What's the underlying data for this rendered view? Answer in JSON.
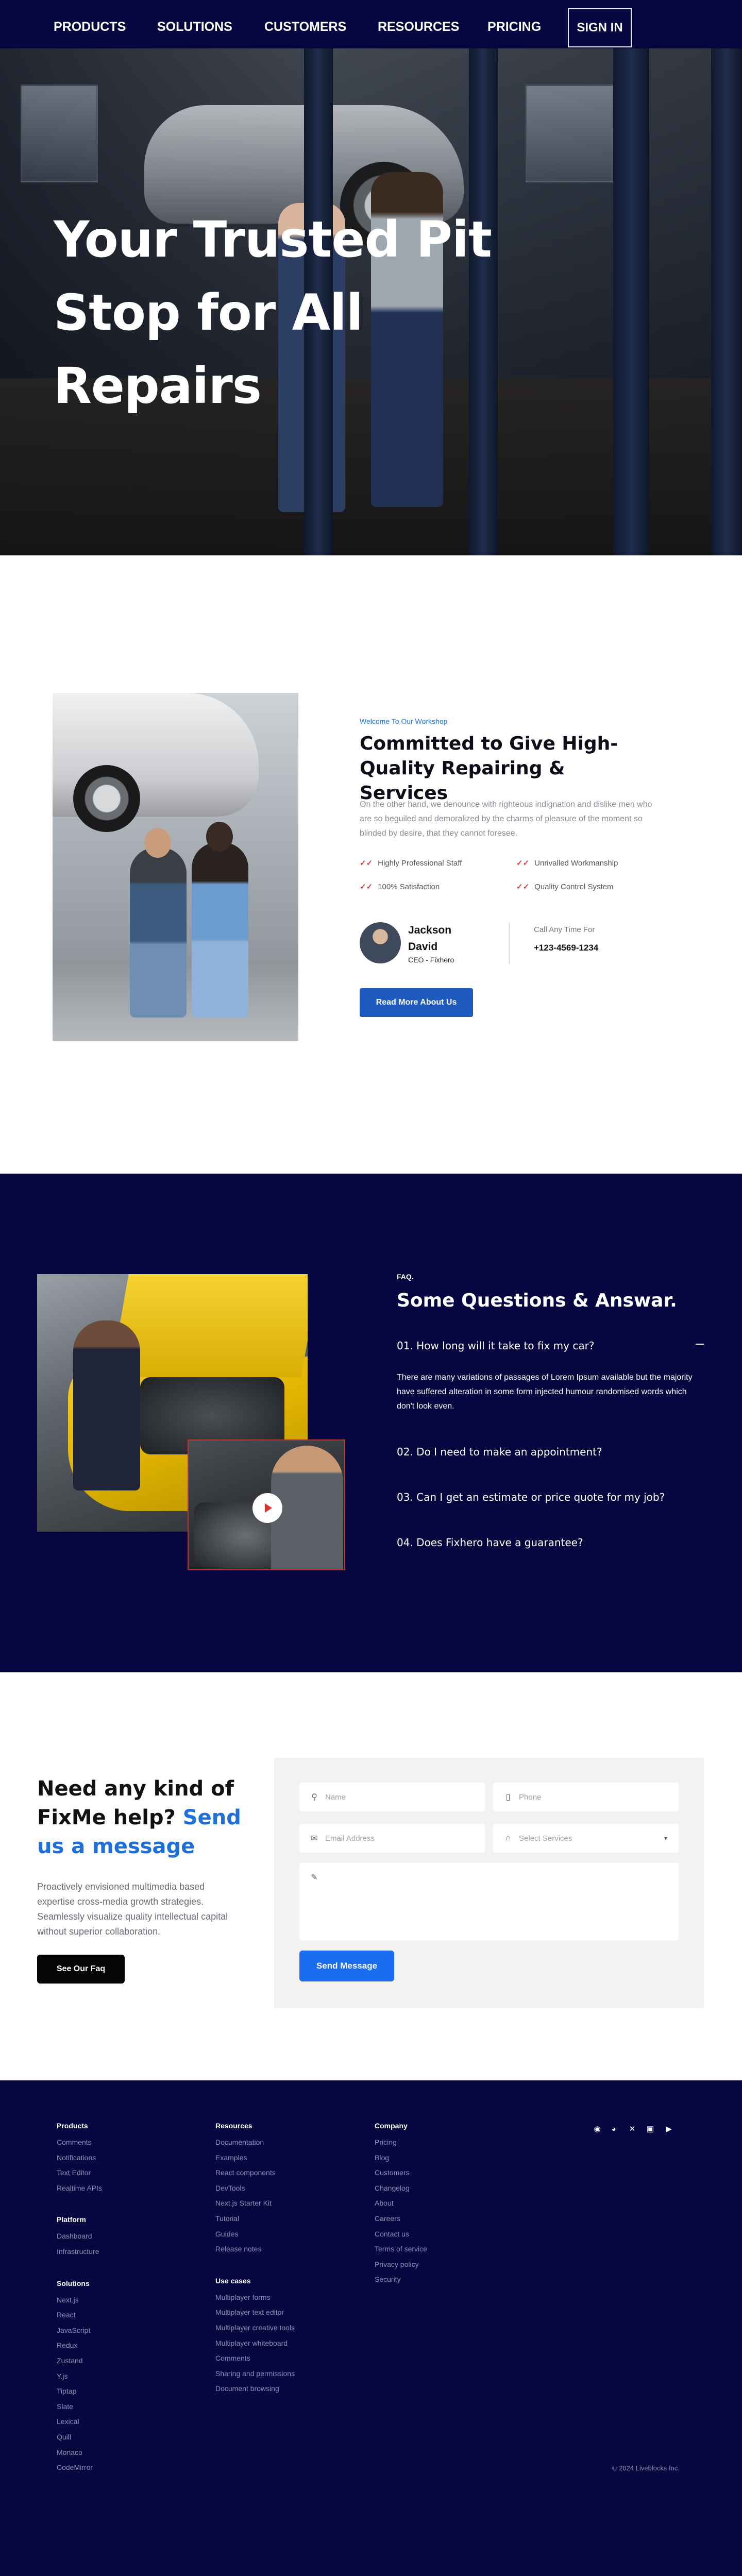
{
  "nav": {
    "items": [
      "PRODUCTS",
      "SOLUTIONS",
      "CUSTOMERS",
      "RESOURCES",
      "PRICING"
    ],
    "signin": "SIGN IN"
  },
  "hero": {
    "title": "Your Trusted Pit Stop for All Repairs"
  },
  "about": {
    "kicker": "Welcome To Our Workshop",
    "title": "Committed to Give High-Quality Repairing & Services",
    "text": "On the other hand, we denounce with righteous indignation and dislike men who are so beguiled and demoralized by the charms of pleasure of the moment so blinded by desire, that they cannot foresee.",
    "features": [
      "Highly Professional Staff",
      "Unrivalled Workmanship",
      "100% Satisfaction",
      "Quality Control System"
    ],
    "person_name": "Jackson David",
    "person_role": "CEO - Fixhero",
    "call_label": "Call Any Time For",
    "call_number": "+123-4569-1234",
    "button": "Read More About Us"
  },
  "faq": {
    "kicker": "FAQ.",
    "title": "Some Questions & Answar.",
    "items": [
      {
        "q": "01. How long will it take to fix my car?",
        "a": "There are many variations of passages of Lorem Ipsum available but the majority have suffered alteration in some form injected humour randomised words which don't look even."
      },
      {
        "q": "02. Do I need to make an appointment?"
      },
      {
        "q": "03. Can I get an estimate or price quote for my job?"
      },
      {
        "q": "04. Does Fixhero have a guarantee?"
      }
    ],
    "toggle": "−"
  },
  "contact": {
    "title_part1": "Need any kind of FixMe help?",
    "title_accent": "Send us a message",
    "text": "Proactively envisioned multimedia based expertise cross-media growth strategies. Seamlessly visualize quality intellectual capital without superior collaboration.",
    "button": "See Our Faq",
    "form": {
      "name": "Name",
      "phone": "Phone",
      "email": "Email Address",
      "service": "Select Services",
      "submit": "Send Message"
    }
  },
  "footer": {
    "col1": [
      {
        "head": "Products",
        "links": [
          "Comments",
          "Notifications",
          "Text Editor",
          "Realtime APIs"
        ]
      },
      {
        "head": "Platform",
        "links": [
          "Dashboard",
          "Infrastructure"
        ]
      },
      {
        "head": "Solutions",
        "links": [
          "Next.js",
          "React",
          "JavaScript",
          "Redux",
          "Zustand",
          "Y.js",
          "Tiptap",
          "Slate",
          "Lexical",
          "Quill",
          "Monaco",
          "CodeMirror"
        ]
      }
    ],
    "col2": [
      {
        "head": "Resources",
        "links": [
          "Documentation",
          "Examples",
          "React components",
          "DevTools",
          "Next.js Starter Kit",
          "Tutorial",
          "Guides",
          "Release notes"
        ]
      },
      {
        "head": "Use cases",
        "links": [
          "Multiplayer forms",
          "Multiplayer text editor",
          "Multiplayer creative tools",
          "Multiplayer whiteboard",
          "Comments",
          "Sharing and permissions",
          "Document browsing"
        ]
      }
    ],
    "col3": [
      {
        "head": "Company",
        "links": [
          "Pricing",
          "Blog",
          "Customers",
          "Changelog",
          "About",
          "Careers",
          "Contact us",
          "Terms of service",
          "Privacy policy",
          "Security"
        ]
      }
    ],
    "social": [
      "github-icon",
      "discord-icon",
      "x-icon",
      "linkedin-icon",
      "youtube-icon"
    ],
    "copyright": "© 2024 Liveblocks Inc."
  },
  "colors": {
    "navy": "#060641",
    "accent_blue": "#1e6fd9",
    "button_blue": "#1f5bbf",
    "check_red": "#e23b3b"
  }
}
